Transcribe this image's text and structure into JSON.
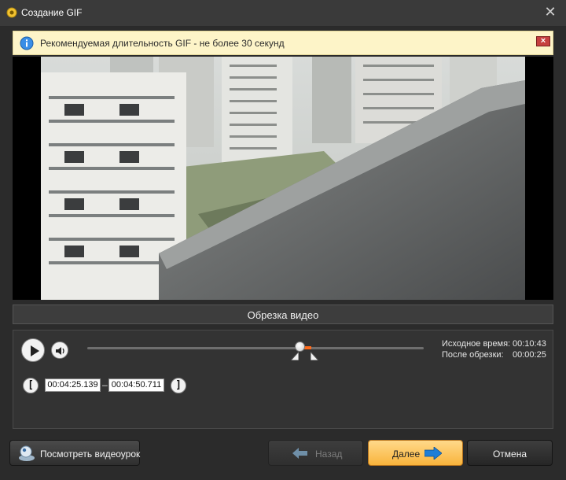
{
  "window": {
    "title": "Создание GIF",
    "close_icon": "close-icon"
  },
  "banner": {
    "icon": "info-icon",
    "text": "Рекомендуемая длительность GIF - не более 30 секунд",
    "close_icon": "close-icon"
  },
  "video": {
    "content": "video-frame"
  },
  "section": {
    "title": "Обрезка видео"
  },
  "player": {
    "play_icon": "play-icon",
    "volume_icon": "volume-icon",
    "progress": 0.63,
    "selection_start": 0.627,
    "selection_end": 0.667
  },
  "info": {
    "source_label": "Исходное время:",
    "source_value": "00:10:43",
    "after_label": "После обрезки:",
    "after_value": "00:00:25"
  },
  "trim": {
    "start_bracket": "[",
    "start_time": "00:04:25.139",
    "separator": "–",
    "end_time": "00:04:50.711",
    "end_bracket": "]"
  },
  "buttons": {
    "tutorial": "Посмотреть видеоурок",
    "back": "Назад",
    "next": "Далее",
    "cancel": "Отмена"
  },
  "colors": {
    "accent": "#ff6a1a",
    "next_button": "#f9b43c",
    "banner_bg": "#fdf4c8",
    "window_bg": "#2b2b2b"
  }
}
